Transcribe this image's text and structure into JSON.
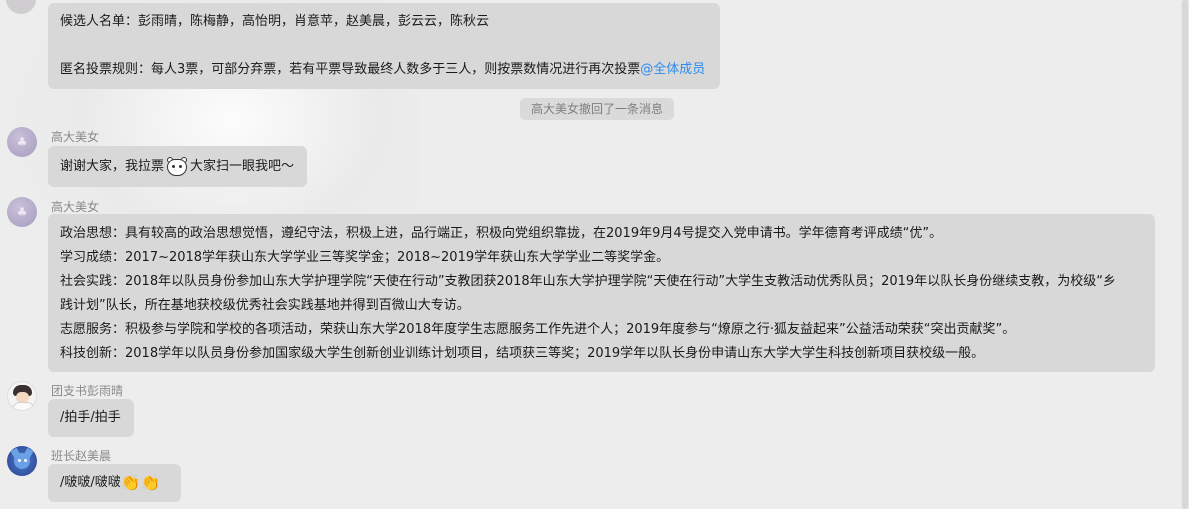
{
  "message_top": {
    "lines": [
      "候选人名单：彭雨晴，陈梅静，高怡明，肖意苹，赵美晨，彭云云，陈秋云",
      "",
      "匿名投票规则：每人3票，可部分弃票，若有平票导致最终人数多于三人，则按票数情况进行再次投票"
    ],
    "mention": "@全体成员"
  },
  "recall_notice": "高大美女撤回了一条消息",
  "message_2": {
    "sender": "高大美女",
    "text_before": "谢谢大家，我拉票",
    "sticker_icon": "bear-face-icon",
    "text_after": "大家扫一眼我吧～"
  },
  "message_3": {
    "sender": "高大美女",
    "lines": [
      "政治思想：具有较高的政治思想觉悟，遵纪守法，积极上进，品行端正，积极向党组织靠拢，在2019年9月4号提交入党申请书。学年德育考评成绩“优”。",
      "学习成绩：2017~2018学年获山东大学学业三等奖学金；2018~2019学年获山东大学学业二等奖学金。",
      "社会实践：2018年以队员身份参加山东大学护理学院“天使在行动”支教团获2018年山东大学护理学院“天使在行动”大学生支教活动优秀队员；2019年以队长身份继续支教，为校级“乡",
      "践计划”队长，所在基地获校级优秀社会实践基地并得到百微山大专访。",
      "志愿服务：积极参与学院和学校的各项活动，荣获山东大学2018年度学生志愿服务工作先进个人；2019年度参与“燎原之行·狐友益起来”公益活动荣获“突出贡献奖”。",
      "科技创新：2018学年以队员身份参加国家级大学生创新创业训练计划项目，结项获三等奖；2019学年以队长身份申请山东大学大学生科技创新项目获校级一般。"
    ]
  },
  "message_4": {
    "sender": "团支书彭雨晴",
    "text": "/拍手/拍手"
  },
  "message_5": {
    "sender": "班长赵美晨",
    "text": "/啵啵/啵啵",
    "emoji": "👏👏",
    "emoji_icon": "clapping-hands-icon"
  },
  "colors": {
    "background": "#ededed",
    "bubble": "#d8d8d8",
    "mention": "#2d8cf0",
    "sender": "#8a8a8a"
  }
}
